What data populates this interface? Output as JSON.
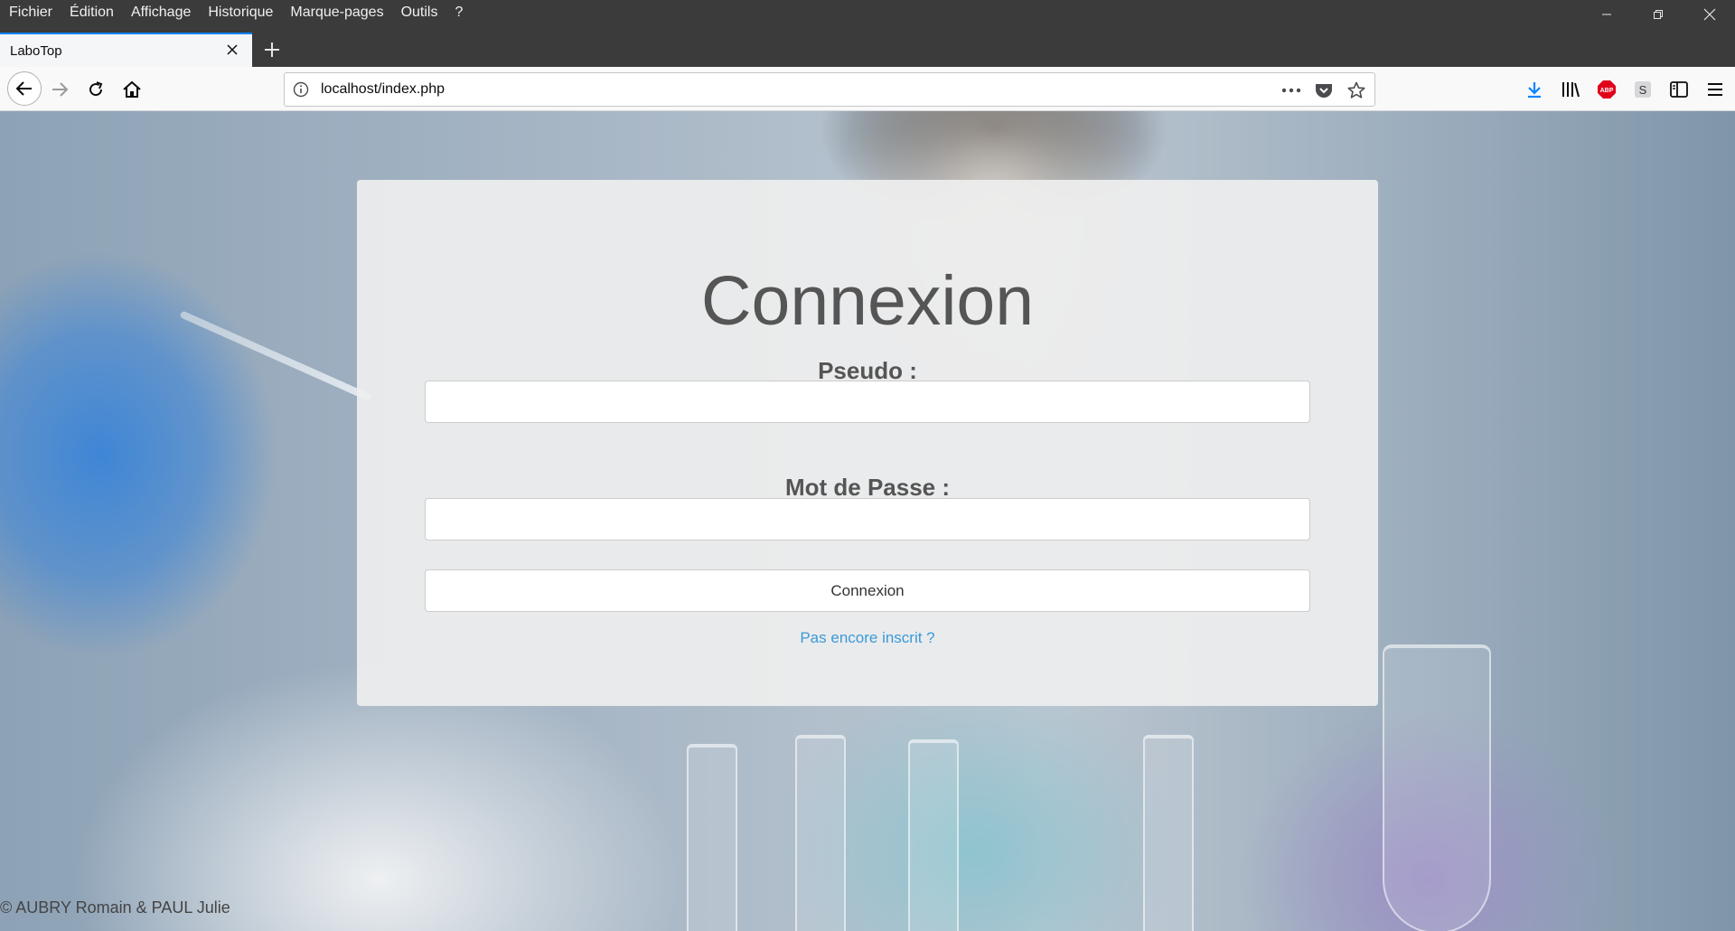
{
  "menu": {
    "items": [
      "Fichier",
      "Édition",
      "Affichage",
      "Historique",
      "Marque-pages",
      "Outils",
      "?"
    ]
  },
  "tab": {
    "title": "LaboTop"
  },
  "urlbar": {
    "url": "localhost/index.php"
  },
  "login": {
    "title": "Connexion",
    "pseudo_label": "Pseudo :",
    "password_label": "Mot de Passe :",
    "pseudo_value": "",
    "password_value": "",
    "submit_label": "Connexion",
    "signup_link": "Pas encore inscrit ?"
  },
  "footer": {
    "copyright": "© AUBRY Romain & PAUL Julie"
  },
  "colors": {
    "accent_tab": "#0a84ff",
    "link": "#3a9ad9",
    "download": "#0a84ff",
    "abp": "#e1001a"
  },
  "icons": [
    "info-icon",
    "more-icon",
    "pocket-icon",
    "star-icon",
    "download-icon",
    "library-icon",
    "adblock-icon",
    "s-extension-icon",
    "sidebar-icon",
    "hamburger-menu-icon"
  ]
}
